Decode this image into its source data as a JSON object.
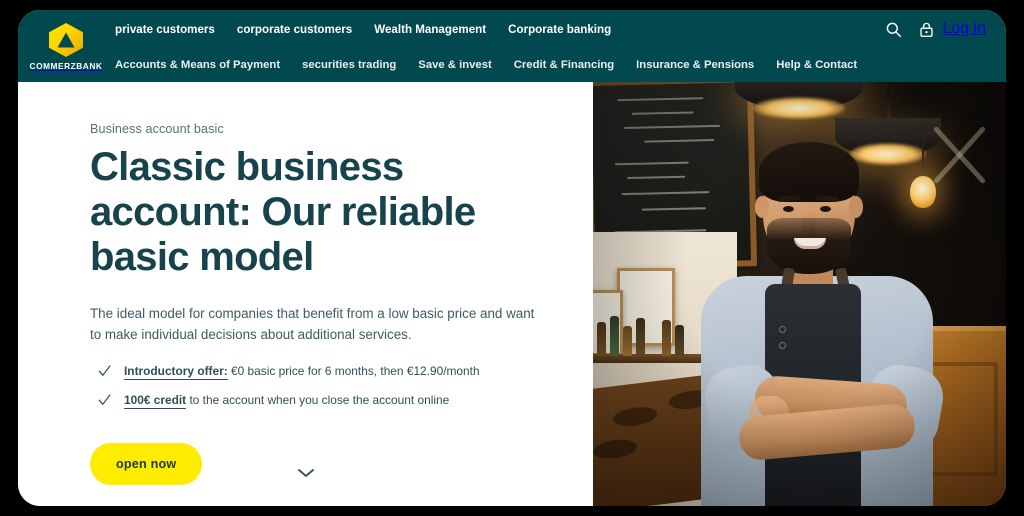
{
  "brand": {
    "wordmark": "COMMERZBANK",
    "logo_icon": "commerzbank-hexagon-logo",
    "logo_color": "#FFE500"
  },
  "header": {
    "background_color": "#02494F",
    "primary_nav": [
      {
        "label": "private customers"
      },
      {
        "label": "corporate customers"
      },
      {
        "label": "Wealth Management"
      },
      {
        "label": "Corporate banking"
      }
    ],
    "secondary_nav": [
      {
        "label": "Accounts & Means of Payment"
      },
      {
        "label": "securities trading"
      },
      {
        "label": "Save & invest"
      },
      {
        "label": "Credit & Financing"
      },
      {
        "label": "Insurance & Pensions"
      },
      {
        "label": "Help & Contact"
      }
    ],
    "actions": {
      "search_icon": "search-icon",
      "lock_icon": "lock-icon",
      "login_label": "Log in"
    }
  },
  "hero": {
    "eyebrow": "Business account basic",
    "title": "Classic business account: Our reliable basic model",
    "subtitle": "The ideal model for companies that benefit from a low basic price and want to make individual decisions about additional services.",
    "title_color": "#17434C",
    "bullets": [
      {
        "check_icon": "check-icon",
        "highlight": "Introductory offer:",
        "rest": " €0 basic price for 6 months, then €12.90/month"
      },
      {
        "check_icon": "check-icon",
        "highlight": "100€ credit",
        "rest": " to the account when you close the account online"
      }
    ],
    "cta_label": "open now",
    "cta_color": "#FFEC00",
    "scroll_cue_icon": "chevron-down-icon",
    "photo_alt": "Smiling bearded business owner with crossed arms standing in a cafe bar with chalkboard menu and pendant lamps"
  }
}
